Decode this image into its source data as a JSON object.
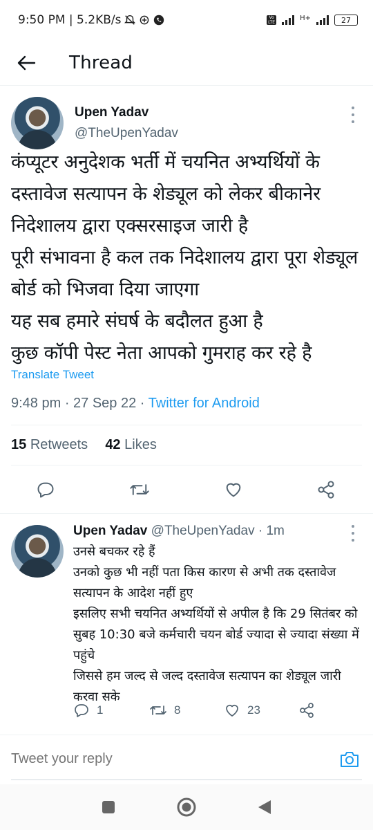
{
  "status": {
    "time_speed": "9:50 PM | 5.2KB/s",
    "network_label": "H+",
    "battery": "27"
  },
  "header": {
    "title": "Thread"
  },
  "tweet": {
    "author_name": "Upen Yadav",
    "author_handle": "@TheUpenYadav",
    "text": "कंप्यूटर अनुदेशक भर्ती में चयनित अभ्यर्थियों के दस्तावेज सत्यापन के शेड्यूल को लेकर बीकानेर निदेशालय द्वारा एक्सरसाइज जारी है\nपूरी संभावना है कल तक निदेशालय द्वारा पूरा शेड्यूल बोर्ड को भिजवा दिया जाएगा\nयह सब हमारे संघर्ष के बदौलत हुआ है\nकुछ कॉपी पेस्ट नेता आपको गुमराह कर रहे है",
    "translate_label": "Translate Tweet",
    "timestamp": "9:48 pm · 27 Sep 22 · ",
    "source": "Twitter for Android",
    "retweets_count": "15",
    "retweets_label": "Retweets",
    "likes_count": "42",
    "likes_label": "Likes"
  },
  "reply": {
    "author_name": "Upen Yadav",
    "author_handle": "@TheUpenYadav · 1m",
    "text": "उनसे बचकर रहे हैं\nउनको कुछ भी नहीं पता किस कारण से अभी तक दस्तावेज सत्यापन के आदेश नहीं हुए\nइसलिए सभी चयनित अभ्यर्थियों से अपील है कि 29 सितंबर को सुबह 10:30 बजे कर्मचारी चयन बोर्ड ज्यादा से ज्यादा संख्या में पहुंचे\nजिससे हम जल्द से जल्द दस्तावेज सत्यापन का शेड्यूल जारी करवा सके",
    "replies": "1",
    "retweets": "8",
    "likes": "23"
  },
  "reply_bar": {
    "placeholder": "Tweet your reply"
  },
  "colors": {
    "accent": "#1d9bf0",
    "secondary_text": "#536471",
    "divider": "#eff3f4"
  },
  "icons": [
    "back-arrow-icon",
    "more-vertical-icon",
    "reply-icon",
    "retweet-icon",
    "like-icon",
    "share-icon",
    "camera-icon",
    "nav-recents-icon",
    "nav-home-icon",
    "nav-back-icon"
  ]
}
